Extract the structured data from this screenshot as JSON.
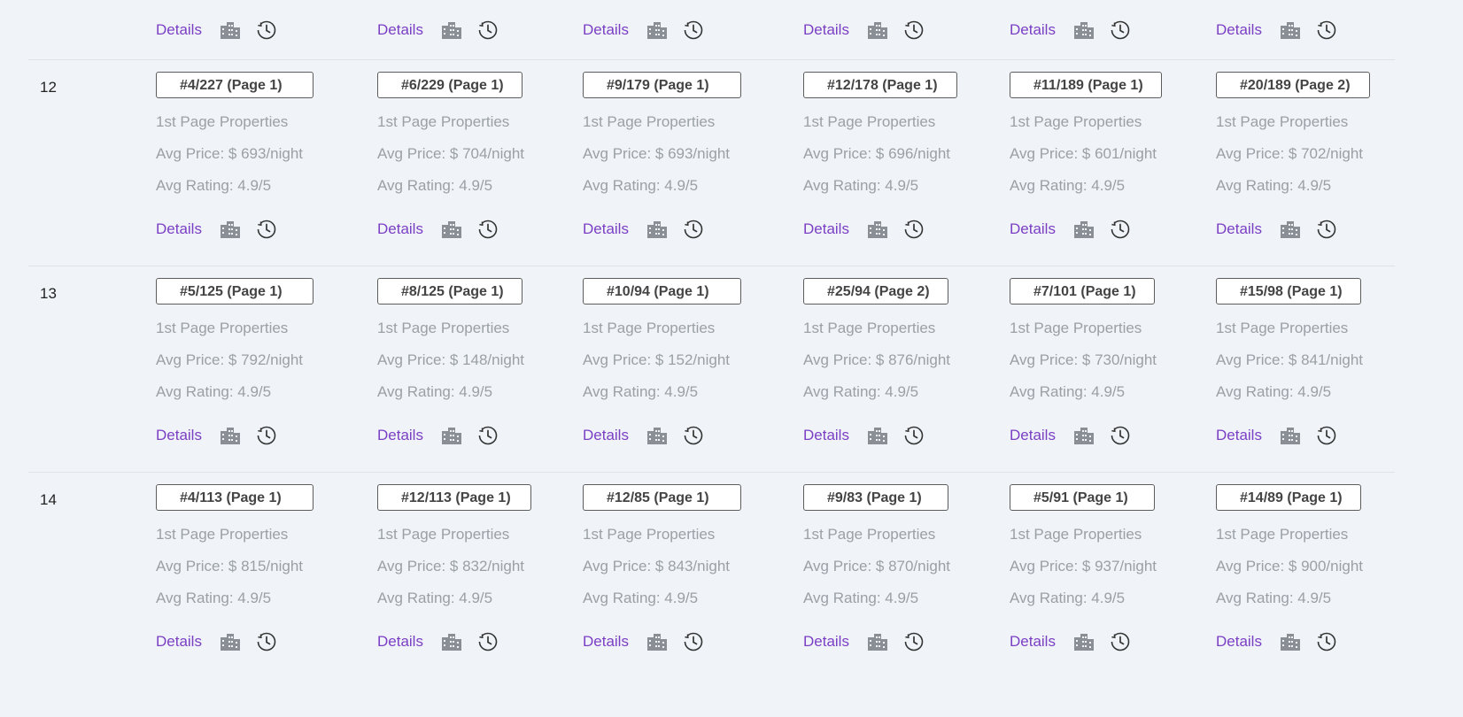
{
  "colors": {
    "background": "#f0f4f8",
    "link": "#7b3fc4",
    "muted_text": "#9aa0a6",
    "badge_border": "#5c5c5c",
    "divider": "#dde3ea"
  },
  "icons": {
    "building": "building-icon",
    "history": "history-clock-icon"
  },
  "top_actions": [
    {
      "details_label": "Details"
    },
    {
      "details_label": "Details"
    },
    {
      "details_label": "Details"
    },
    {
      "details_label": "Details"
    },
    {
      "details_label": "Details"
    },
    {
      "details_label": "Details"
    }
  ],
  "rows": [
    {
      "number": "12",
      "cells": [
        {
          "rank": "#4/227 (Page 1)",
          "properties": "1st Page Properties",
          "avg_price": "Avg Price: $ 693/night",
          "avg_rating": "Avg Rating: 4.9/5",
          "details_label": "Details"
        },
        {
          "rank": "#6/229 (Page 1)",
          "properties": "1st Page Properties",
          "avg_price": "Avg Price: $ 704/night",
          "avg_rating": "Avg Rating: 4.9/5",
          "details_label": "Details"
        },
        {
          "rank": "#9/179 (Page 1)",
          "properties": "1st Page Properties",
          "avg_price": "Avg Price: $ 693/night",
          "avg_rating": "Avg Rating: 4.9/5",
          "details_label": "Details"
        },
        {
          "rank": "#12/178 (Page 1)",
          "properties": "1st Page Properties",
          "avg_price": "Avg Price: $ 696/night",
          "avg_rating": "Avg Rating: 4.9/5",
          "details_label": "Details"
        },
        {
          "rank": "#11/189 (Page 1)",
          "properties": "1st Page Properties",
          "avg_price": "Avg Price: $ 601/night",
          "avg_rating": "Avg Rating: 4.9/5",
          "details_label": "Details"
        },
        {
          "rank": "#20/189 (Page 2)",
          "properties": "1st Page Properties",
          "avg_price": "Avg Price: $ 702/night",
          "avg_rating": "Avg Rating: 4.9/5",
          "details_label": "Details"
        }
      ]
    },
    {
      "number": "13",
      "cells": [
        {
          "rank": "#5/125 (Page 1)",
          "properties": "1st Page Properties",
          "avg_price": "Avg Price: $ 792/night",
          "avg_rating": "Avg Rating: 4.9/5",
          "details_label": "Details"
        },
        {
          "rank": "#8/125 (Page 1)",
          "properties": "1st Page Properties",
          "avg_price": "Avg Price: $ 148/night",
          "avg_rating": "Avg Rating: 4.9/5",
          "details_label": "Details"
        },
        {
          "rank": "#10/94 (Page 1)",
          "properties": "1st Page Properties",
          "avg_price": "Avg Price: $ 152/night",
          "avg_rating": "Avg Rating: 4.9/5",
          "details_label": "Details"
        },
        {
          "rank": "#25/94 (Page 2)",
          "properties": "1st Page Properties",
          "avg_price": "Avg Price: $ 876/night",
          "avg_rating": "Avg Rating: 4.9/5",
          "details_label": "Details"
        },
        {
          "rank": "#7/101 (Page 1)",
          "properties": "1st Page Properties",
          "avg_price": "Avg Price: $ 730/night",
          "avg_rating": "Avg Rating: 4.9/5",
          "details_label": "Details"
        },
        {
          "rank": "#15/98 (Page 1)",
          "properties": "1st Page Properties",
          "avg_price": "Avg Price: $ 841/night",
          "avg_rating": "Avg Rating: 4.9/5",
          "details_label": "Details"
        }
      ]
    },
    {
      "number": "14",
      "cells": [
        {
          "rank": "#4/113 (Page 1)",
          "properties": "1st Page Properties",
          "avg_price": "Avg Price: $ 815/night",
          "avg_rating": "Avg Rating: 4.9/5",
          "details_label": "Details"
        },
        {
          "rank": "#12/113 (Page 1)",
          "properties": "1st Page Properties",
          "avg_price": "Avg Price: $ 832/night",
          "avg_rating": "Avg Rating: 4.9/5",
          "details_label": "Details"
        },
        {
          "rank": "#12/85 (Page 1)",
          "properties": "1st Page Properties",
          "avg_price": "Avg Price: $ 843/night",
          "avg_rating": "Avg Rating: 4.9/5",
          "details_label": "Details"
        },
        {
          "rank": "#9/83 (Page 1)",
          "properties": "1st Page Properties",
          "avg_price": "Avg Price: $ 870/night",
          "avg_rating": "Avg Rating: 4.9/5",
          "details_label": "Details"
        },
        {
          "rank": "#5/91 (Page 1)",
          "properties": "1st Page Properties",
          "avg_price": "Avg Price: $ 937/night",
          "avg_rating": "Avg Rating: 4.9/5",
          "details_label": "Details"
        },
        {
          "rank": "#14/89 (Page 1)",
          "properties": "1st Page Properties",
          "avg_price": "Avg Price: $ 900/night",
          "avg_rating": "Avg Rating: 4.9/5",
          "details_label": "Details"
        }
      ]
    }
  ]
}
